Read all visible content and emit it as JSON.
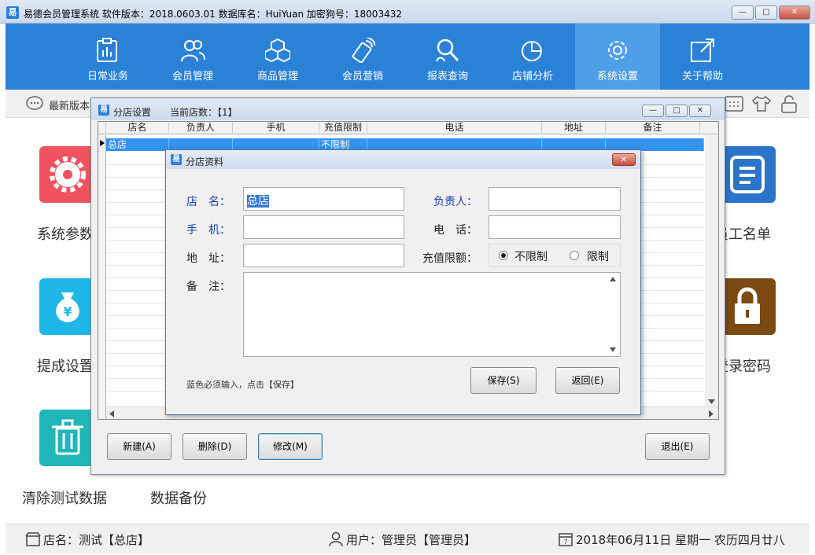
{
  "window": {
    "title": "易德会员管理系统   软件版本：2018.0603.01   数据库名：HuiYuan   加密狗号：18003432",
    "icon": "app-logo-icon"
  },
  "nav": {
    "items": [
      {
        "label": "日常业务",
        "icon": "clipboard-chart-icon"
      },
      {
        "label": "会员管理",
        "icon": "users-icon"
      },
      {
        "label": "商品管理",
        "icon": "boxes-icon"
      },
      {
        "label": "会员营销",
        "icon": "phone-signal-icon"
      },
      {
        "label": "报表查询",
        "icon": "search-user-icon"
      },
      {
        "label": "店铺分析",
        "icon": "pie-chart-icon"
      },
      {
        "label": "系统设置",
        "icon": "gear-icon",
        "active": true
      },
      {
        "label": "关于帮助",
        "icon": "help-arrow-icon"
      }
    ]
  },
  "notice": {
    "text": "最新版本"
  },
  "tiles": {
    "left": [
      {
        "label": "系统参数",
        "color": "#f0525f",
        "icon": "gear-icon"
      },
      {
        "label": "提成设置",
        "color": "#1fb6e8",
        "icon": "money-bag-icon"
      },
      {
        "label": "清除测试数据",
        "color": "#1fb6b9",
        "icon": "trash-icon"
      }
    ],
    "backup_label": "数据备份",
    "right": [
      {
        "label": "员工名单",
        "color": "#2a74c9",
        "icon": "document-icon"
      },
      {
        "label": "登录密码",
        "color": "#7a4a12",
        "icon": "lock-icon"
      }
    ]
  },
  "status": {
    "store": "店名：测试【总店】",
    "user": "用户：管理员【管理员】",
    "date": "2018年06月11日 星期一 农历四月廿八"
  },
  "branch_window": {
    "title": "分店设置",
    "count_label": "当前店数：【1】",
    "columns": [
      "店名",
      "负责人",
      "手机",
      "充值限制",
      "电话",
      "地址",
      "备注"
    ],
    "rows": [
      {
        "name": "总店",
        "manager": "",
        "mobile": "",
        "limit": "不限制",
        "phone": "",
        "address": "",
        "remark": ""
      }
    ],
    "buttons": {
      "new": "新建(A)",
      "delete": "删除(D)",
      "edit": "修改(M)",
      "exit": "退出(E)"
    }
  },
  "dialog": {
    "title": "分店资料",
    "fields": {
      "store_name_label": "店　名：",
      "store_name_value": "总店",
      "manager_label": "负责人：",
      "manager_value": "",
      "mobile_label": "手　机：",
      "mobile_value": "",
      "phone_label": "电　话：",
      "phone_value": "",
      "address_label": "地　址：",
      "address_value": "",
      "limit_label": "充值限额：",
      "limit_options": [
        "不限制",
        "限制"
      ],
      "limit_selected": "不限制",
      "remark_label": "备　注：",
      "remark_value": ""
    },
    "hint": "蓝色必须输入，点击【保存】",
    "buttons": {
      "save": "保存(S)",
      "back": "返回(E)"
    }
  }
}
